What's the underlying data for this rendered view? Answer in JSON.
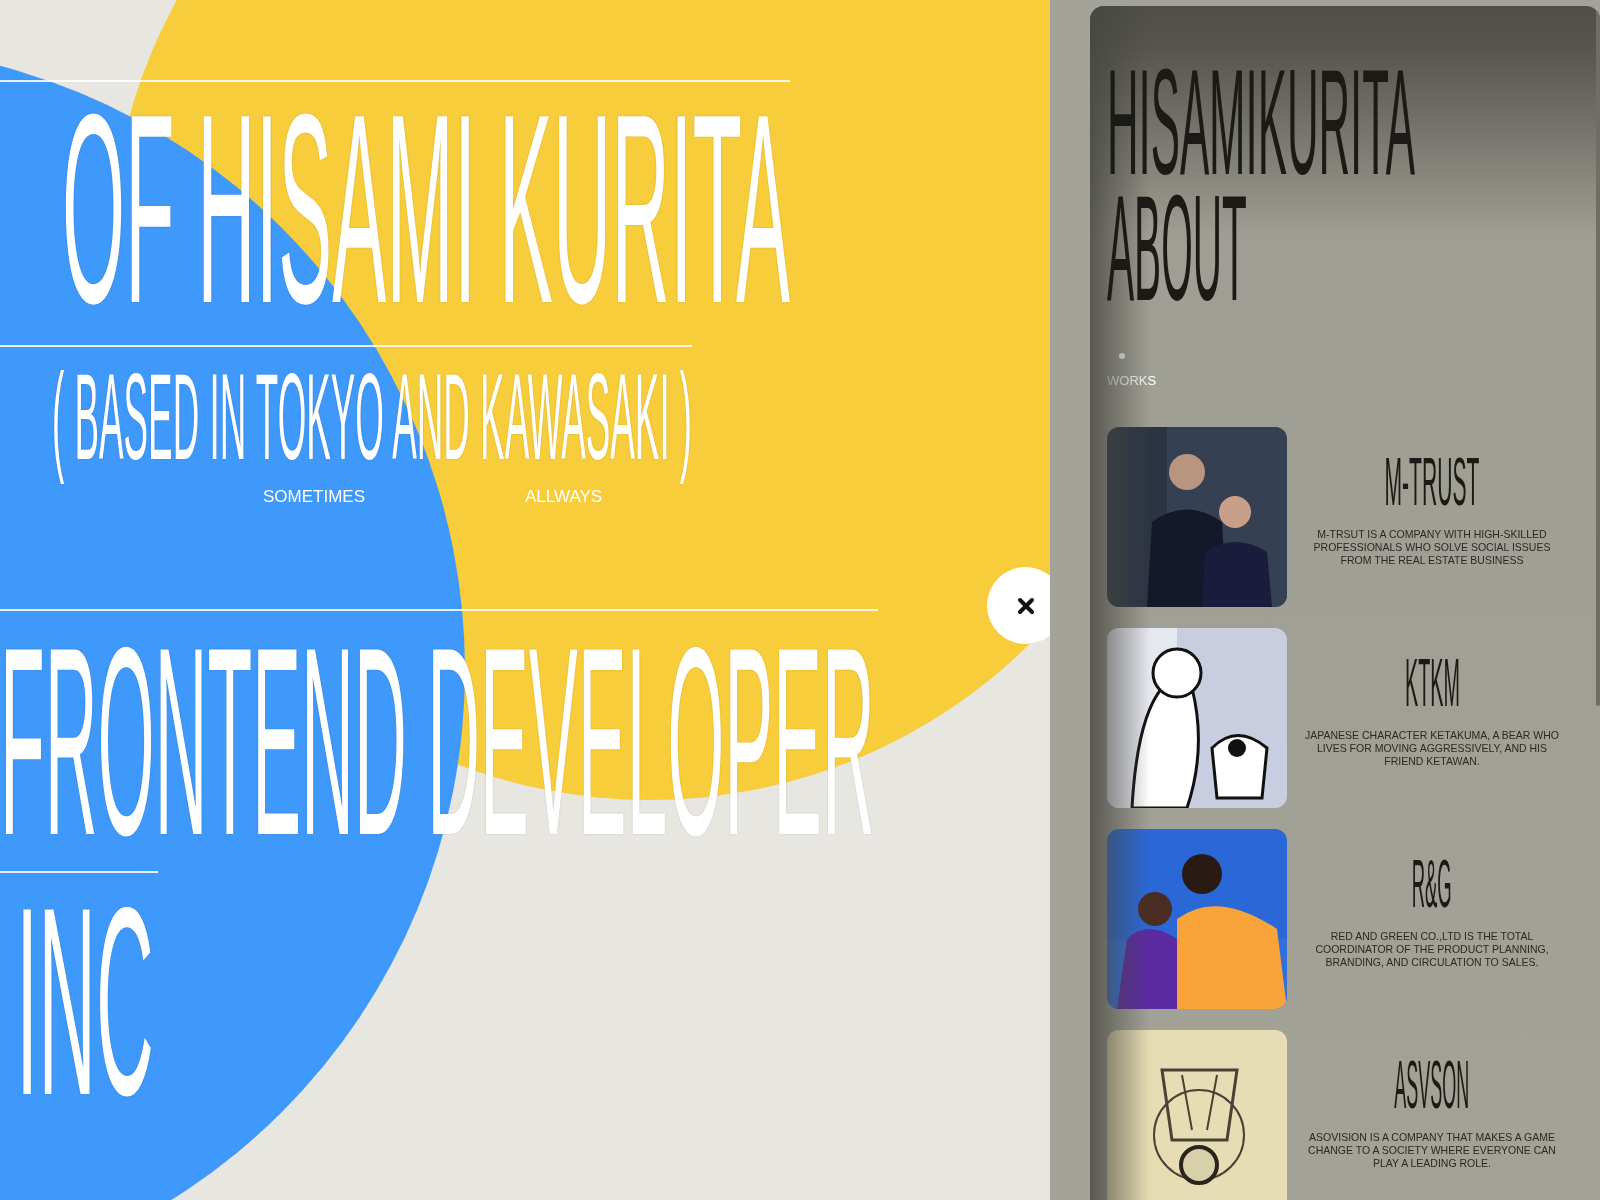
{
  "hero": {
    "title": "OF HISAMI KURITA",
    "location": "( BASED IN TOKYO AND KAWASAKI )",
    "notes": [
      "SOMETIMES",
      "ALLWAYS"
    ],
    "role": "FRONTEND DEVELOPER",
    "company": "INC"
  },
  "panel": {
    "title": "HISAMIKURITA",
    "subtitle": "ABOUT",
    "section": "WORKS",
    "works": [
      {
        "name": "M-TRUST",
        "description": "M-TRSUT IS A COMPANY WITH HIGH-SKILLED PROFESSIONALS WHO SOLVE SOCIAL ISSUES FROM THE REAL ESTATE BUSINESS",
        "kind": "picture"
      },
      {
        "name": "KTKM",
        "description": "JAPANESE CHARACTER KETAKUMA, A BEAR WHO LIVES FOR MOVING AGGRESSIVELY, AND HIS FRIEND KETAWAN.",
        "kind": "picture"
      },
      {
        "name": "R&G",
        "description": "RED AND GREEN CO.,LTD IS THE TOTAL COORDINATOR OF THE PRODUCT PLANNING, BRANDING, AND CIRCULATION TO SALES.",
        "kind": "picture"
      },
      {
        "name": "ASVSON",
        "description": "ASOVISION IS A COMPANY THAT MAKES A GAME CHANGE TO A SOCIETY WHERE EVERYONE CAN PLAY A LEADING ROLE.",
        "kind": "picture"
      }
    ]
  }
}
